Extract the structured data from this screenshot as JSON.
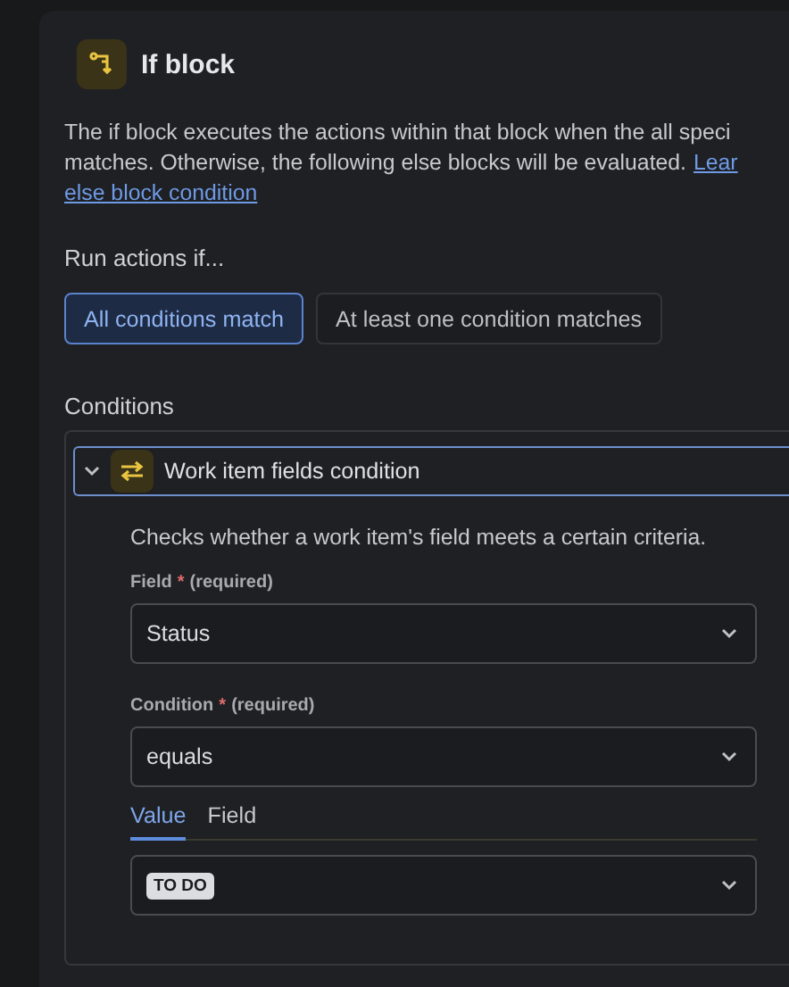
{
  "block": {
    "title": "If block",
    "description_lines": [
      "The if block executes the actions within that block when the all speci",
      "matches. Otherwise, the following else blocks will be evaluated."
    ],
    "link_parts": [
      "Lear",
      "else block condition"
    ]
  },
  "run_actions": {
    "label": "Run actions if...",
    "options": [
      {
        "label": "All conditions match",
        "selected": true
      },
      {
        "label": "At least one condition matches",
        "selected": false
      }
    ]
  },
  "conditions": {
    "label": "Conditions",
    "items": [
      {
        "title": "Work item fields condition",
        "expanded": true,
        "description": "Checks whether a work item's field meets a certain criteria.",
        "fields": [
          {
            "label": "Field",
            "required_mark": "*",
            "required_note": "(required)",
            "value": "Status"
          },
          {
            "label": "Condition",
            "required_mark": "*",
            "required_note": "(required)",
            "value": "equals"
          }
        ],
        "tabs": [
          {
            "label": "Value",
            "selected": true
          },
          {
            "label": "Field",
            "selected": false
          }
        ],
        "value_select": {
          "badge": "TO DO"
        }
      }
    ]
  }
}
